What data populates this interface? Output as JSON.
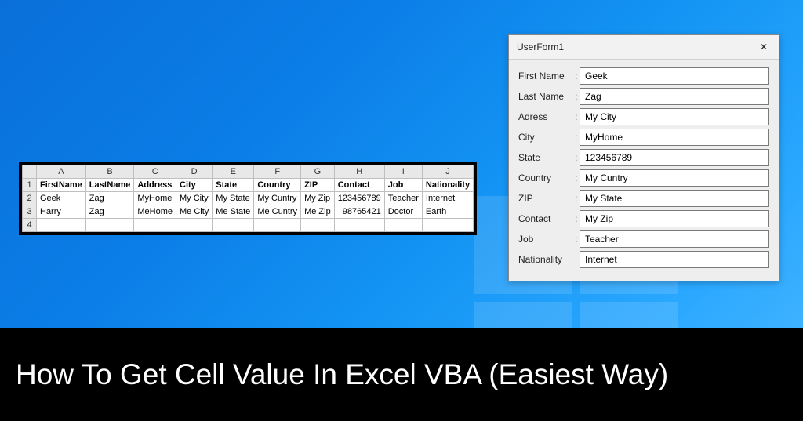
{
  "sheet": {
    "columns": [
      "A",
      "B",
      "C",
      "D",
      "E",
      "F",
      "G",
      "H",
      "I",
      "J"
    ],
    "headers": [
      "FirstName",
      "LastName",
      "Address",
      "City",
      "State",
      "Country",
      "ZIP",
      "Contact",
      "Job",
      "Nationality"
    ],
    "rows": [
      {
        "n": "2",
        "cells": [
          "Geek",
          "Zag",
          "MyHome",
          "My City",
          "My State",
          "My Cuntry",
          "My Zip",
          "123456789",
          "Teacher",
          "Internet"
        ]
      },
      {
        "n": "3",
        "cells": [
          "Harry",
          "Zag",
          "MeHome",
          "Me City",
          "Me State",
          "Me Cuntry",
          "Me Zip",
          "98765421",
          "Doctor",
          "Earth"
        ]
      }
    ],
    "emptyRow": "4",
    "headerRowNum": "1"
  },
  "userform": {
    "title": "UserForm1",
    "fields": [
      {
        "label": "First Name",
        "colon": ":",
        "value": "Geek"
      },
      {
        "label": "Last Name",
        "colon": ":",
        "value": "Zag"
      },
      {
        "label": "Adress",
        "colon": ":",
        "value": "My City"
      },
      {
        "label": "City",
        "colon": ":",
        "value": "MyHome"
      },
      {
        "label": "State",
        "colon": ":",
        "value": "123456789"
      },
      {
        "label": "Country",
        "colon": ":",
        "value": "My Cuntry"
      },
      {
        "label": "ZIP",
        "colon": ":",
        "value": "My State"
      },
      {
        "label": "Contact",
        "colon": ":",
        "value": "My Zip"
      },
      {
        "label": "Job",
        "colon": ":",
        "value": "Teacher"
      },
      {
        "label": "Nationality",
        "colon": "",
        "value": "Internet"
      }
    ]
  },
  "banner": {
    "title": "How To Get Cell Value In Excel VBA (Easiest Way)"
  }
}
